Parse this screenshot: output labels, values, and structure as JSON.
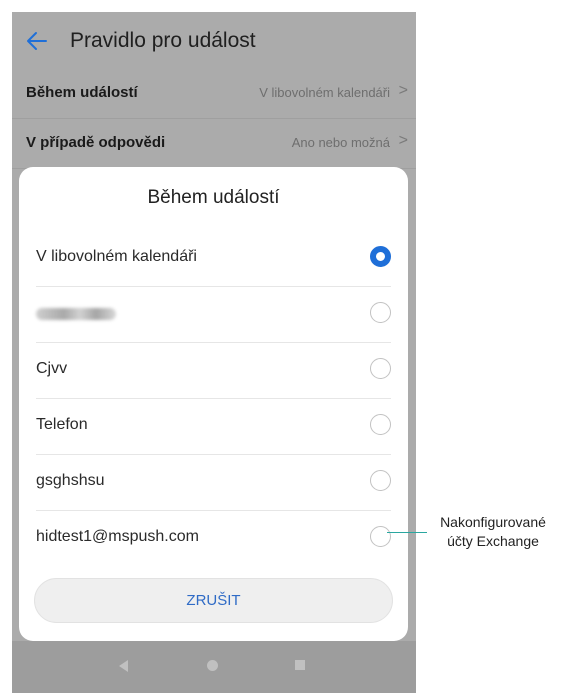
{
  "appbar": {
    "title": "Pravidlo pro událost",
    "back_icon": "back-arrow-icon"
  },
  "settings": [
    {
      "label": "Během událostí",
      "value": "V libovolném kalendáři",
      "chevron": ">"
    },
    {
      "label": "V případě odpovědi",
      "value": "Ano nebo možná",
      "chevron": ">"
    }
  ],
  "dialog": {
    "title": "Během událostí",
    "options": [
      {
        "label": "V libovolném kalendáři",
        "selected": true
      },
      {
        "label": "",
        "selected": false,
        "blurred": true
      },
      {
        "label": "Cjvv",
        "selected": false
      },
      {
        "label": "Telefon",
        "selected": false
      },
      {
        "label": "gsghshsu",
        "selected": false
      },
      {
        "label": "hidtest1@mspush.com",
        "selected": false
      }
    ],
    "cancel_label": "ZRUŠIT",
    "accent_color": "#1f6fd8"
  },
  "navbar": {
    "icons": [
      "nav-back-icon",
      "nav-home-icon",
      "nav-recent-icon"
    ]
  },
  "callout": {
    "line1": "Nakonfigurované",
    "line2": "účty Exchange",
    "color": "#2aa7a0"
  }
}
